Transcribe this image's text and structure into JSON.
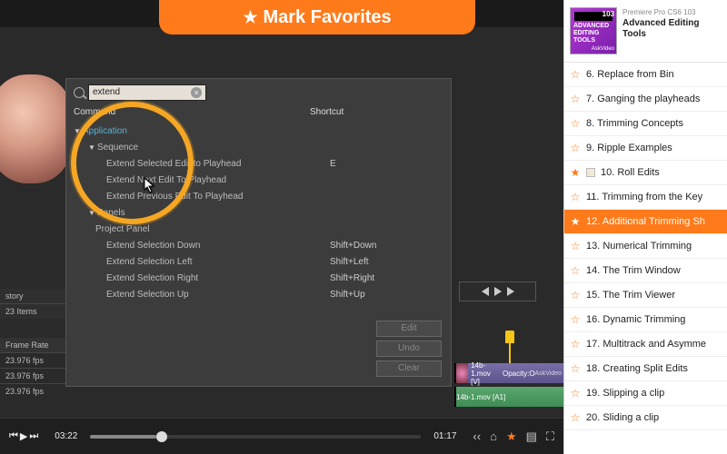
{
  "banner": {
    "star": "★",
    "text": "Mark Favorites"
  },
  "dialog": {
    "search_value": "extend",
    "col_command": "Command",
    "col_shortcut": "Shortcut",
    "tree": {
      "application": "Application",
      "sequence": "Sequence",
      "panels": "Panels",
      "project_panel": "Project Panel",
      "rows": [
        {
          "label": "Extend Selected Edit to Playhead",
          "sc": "E"
        },
        {
          "label": "Extend Next Edit To Playhead",
          "sc": ""
        },
        {
          "label": "Extend Previous Edit To Playhead",
          "sc": ""
        }
      ],
      "panel_rows": [
        {
          "label": "Extend Selection Down",
          "sc": "Shift+Down"
        },
        {
          "label": "Extend Selection Left",
          "sc": "Shift+Left"
        },
        {
          "label": "Extend Selection Right",
          "sc": "Shift+Right"
        },
        {
          "label": "Extend Selection Up",
          "sc": "Shift+Up"
        }
      ]
    },
    "buttons": {
      "edit": "Edit",
      "undo": "Undo",
      "clear": "Clear"
    }
  },
  "left_panels": {
    "history": "story",
    "items_count": "23 Items",
    "frame_rate_header": "Frame Rate",
    "frame_rate_value": "23.976 fps"
  },
  "clips": {
    "video_label": "14b-1.mov [V]",
    "video_right": "Opacity:O",
    "audio_label": "14b-1.mov [A1]",
    "watermark": "AskVideo"
  },
  "player": {
    "time_elapsed": "03:22",
    "time_total": "01:17"
  },
  "course": {
    "overline": "Premiere Pro CS6 103",
    "title": "Advanced Editing Tools",
    "art_num": "103",
    "art_line1": "ADVANCED",
    "art_line2": "EDITING TOOLS",
    "art_brand": "AskVideo"
  },
  "chapters": [
    {
      "n": "6.",
      "t": "Replace from Bin",
      "fav": false,
      "pip": false,
      "active": false
    },
    {
      "n": "7.",
      "t": "Ganging the playheads",
      "fav": false,
      "pip": false,
      "active": false
    },
    {
      "n": "8.",
      "t": "Trimming Concepts",
      "fav": false,
      "pip": false,
      "active": false
    },
    {
      "n": "9.",
      "t": "Ripple Examples",
      "fav": false,
      "pip": false,
      "active": false
    },
    {
      "n": "10.",
      "t": "Roll Edits",
      "fav": true,
      "pip": true,
      "active": false
    },
    {
      "n": "11.",
      "t": "Trimming from the Key",
      "fav": false,
      "pip": false,
      "active": false
    },
    {
      "n": "12.",
      "t": "Additional Trimming Sh",
      "fav": true,
      "pip": false,
      "active": true
    },
    {
      "n": "13.",
      "t": "Numerical Trimming",
      "fav": false,
      "pip": false,
      "active": false
    },
    {
      "n": "14.",
      "t": "The Trim Window",
      "fav": false,
      "pip": false,
      "active": false
    },
    {
      "n": "15.",
      "t": "The Trim Viewer",
      "fav": false,
      "pip": false,
      "active": false
    },
    {
      "n": "16.",
      "t": "Dynamic Trimming",
      "fav": false,
      "pip": false,
      "active": false
    },
    {
      "n": "17.",
      "t": "Multitrack and Asymme",
      "fav": false,
      "pip": false,
      "active": false
    },
    {
      "n": "18.",
      "t": "Creating Split Edits",
      "fav": false,
      "pip": false,
      "active": false
    },
    {
      "n": "19.",
      "t": "Slipping a clip",
      "fav": false,
      "pip": false,
      "active": false
    },
    {
      "n": "20.",
      "t": "Sliding a clip",
      "fav": false,
      "pip": false,
      "active": false
    }
  ]
}
